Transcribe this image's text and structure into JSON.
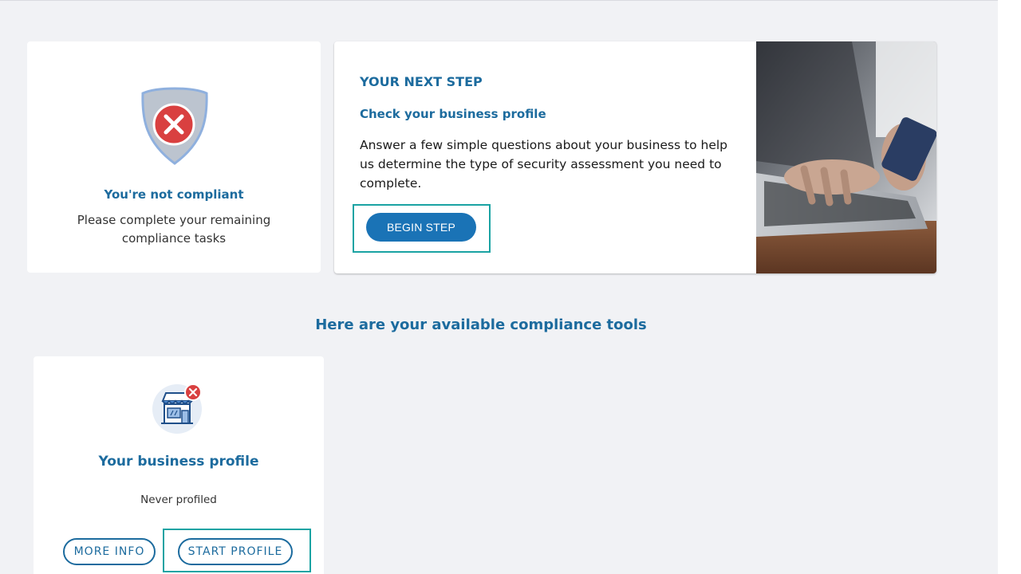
{
  "status_card": {
    "title": "You're not compliant",
    "description": "Please complete your remaining compliance tasks",
    "icon": "shield-error-icon"
  },
  "next_step": {
    "heading": "YOUR NEXT STEP",
    "subheading": "Check your business profile",
    "description": "Answer a few simple questions about your business to help us determine the type of security assessment you need to complete.",
    "button_label": "BEGIN STEP"
  },
  "tools_section": {
    "title": "Here are your available compliance tools"
  },
  "business_profile_card": {
    "title": "Your business profile",
    "status": "Never profiled",
    "more_info_label": "MORE INFO",
    "start_profile_label": "START PROFILE",
    "icon": "storefront-icon"
  },
  "colors": {
    "brand_blue": "#1c6b9e",
    "button_blue": "#1a73b6",
    "error_red": "#d94040",
    "highlight_teal": "#1aa3a3"
  }
}
